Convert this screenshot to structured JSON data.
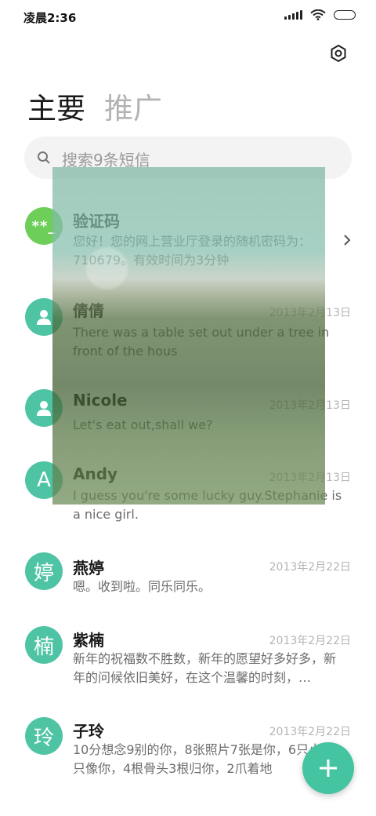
{
  "status": {
    "time": "凌晨2:36"
  },
  "tabs": [
    {
      "label": "主要"
    },
    {
      "label": "推广"
    }
  ],
  "search": {
    "placeholder": "搜索9条短信"
  },
  "conversations": [
    {
      "avatar": "**_",
      "name": "验证码",
      "date": "",
      "preview": "您好！您的网上营业厅登录的随机密码为：710679。有效时间为3分钟"
    },
    {
      "avatar": "",
      "name": "倩倩",
      "date": "2013年2月13日",
      "preview": "There was a table set out under a tree in front of the hous"
    },
    {
      "avatar": "",
      "name": "Nicole",
      "date": "2013年2月13日",
      "preview": "Let's eat out,shall we?"
    },
    {
      "avatar": "A",
      "name": "Andy",
      "date": "2013年2月13日",
      "preview": "I guess you're some lucky guy.Stephanie is a nice girl."
    },
    {
      "avatar": "婷",
      "name": "燕婷",
      "date": "2013年2月22日",
      "preview": "嗯。收到啦。同乐同乐。"
    },
    {
      "avatar": "楠",
      "name": "紫楠",
      "date": "2013年2月22日",
      "preview": "新年的祝福数不胜数，新年的愿望好多好多，新年的问候依旧美好，在这个温馨的时刻，…"
    },
    {
      "avatar": "玲",
      "name": "子玲",
      "date": "2013年2月22日",
      "preview": "10分想念9别的你，8张照片7张是你，6只小狗5只像你，4根骨头3根归你，2爪着地"
    }
  ],
  "colors": {
    "accent": "#44c4a1",
    "avatar_green": "#6dce5a"
  }
}
